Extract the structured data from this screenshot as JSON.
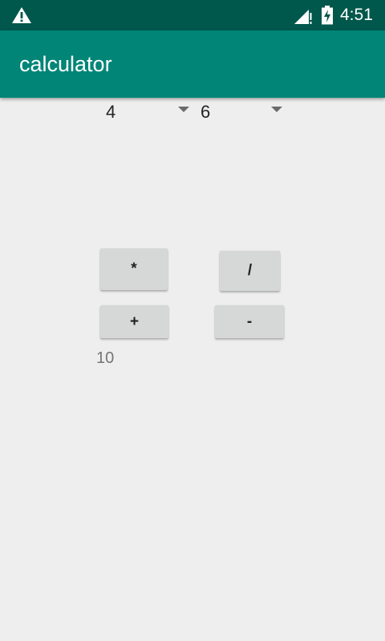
{
  "status_bar": {
    "time": "4:51",
    "icons": [
      "warning-icon",
      "signal-icon",
      "battery-charging-icon"
    ]
  },
  "app_bar": {
    "title": "calculator"
  },
  "inputs": {
    "first_value": "4",
    "second_value": "6"
  },
  "operations": {
    "multiply": "*",
    "divide": "/",
    "add": "+",
    "subtract": "-"
  },
  "result": "10",
  "colors": {
    "status_bar": "#00574b",
    "app_bar": "#008577",
    "background": "#eeeeee",
    "button": "#d6d7d7"
  }
}
